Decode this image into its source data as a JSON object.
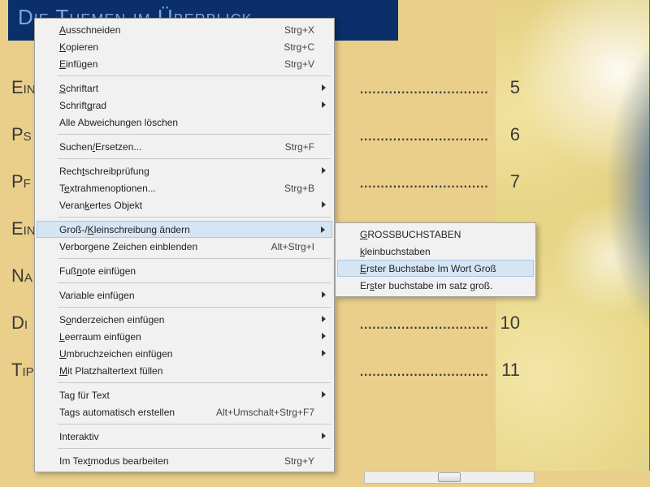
{
  "banner": {
    "title": "Die Themen im Überblick"
  },
  "toc": [
    {
      "label": "Ein",
      "num": "5",
      "dotsVisible": true
    },
    {
      "label": "Ps",
      "num": "6",
      "dotsVisible": true
    },
    {
      "label": "Pf",
      "num": "7",
      "dotsVisible": true
    },
    {
      "label": "Ein",
      "num": "",
      "dotsVisible": false
    },
    {
      "label": "Na",
      "num": "",
      "dotsVisible": false
    },
    {
      "label": "Di",
      "num": "10",
      "dotsVisible": true
    },
    {
      "label": "Tip",
      "num": "11",
      "dotsVisible": true
    }
  ],
  "dots": ".......................................",
  "menu": {
    "main": [
      {
        "type": "item",
        "label": "Ausschneiden",
        "u": 0,
        "shortcut": "Strg+X"
      },
      {
        "type": "item",
        "label": "Kopieren",
        "u": 0,
        "shortcut": "Strg+C"
      },
      {
        "type": "item",
        "label": "Einfügen",
        "u": 0,
        "shortcut": "Strg+V"
      },
      {
        "type": "sep"
      },
      {
        "type": "item",
        "label": "Schriftart",
        "u": 0,
        "submenu": true
      },
      {
        "type": "item",
        "label": "Schriftgrad",
        "u": 7,
        "submenu": true
      },
      {
        "type": "item",
        "label": "Alle Abweichungen löschen"
      },
      {
        "type": "sep"
      },
      {
        "type": "item",
        "label": "Suchen/Ersetzen...",
        "u": 6,
        "shortcut": "Strg+F"
      },
      {
        "type": "sep"
      },
      {
        "type": "item",
        "label": "Rechtschreibprüfung",
        "u": 4,
        "submenu": true
      },
      {
        "type": "item",
        "label": "Textrahmenoptionen...",
        "u": 1,
        "shortcut": "Strg+B"
      },
      {
        "type": "item",
        "label": "Verankertes Objekt",
        "u": 5,
        "submenu": true
      },
      {
        "type": "sep"
      },
      {
        "type": "item",
        "label": "Groß-/Kleinschreibung ändern",
        "u": 6,
        "submenu": true,
        "hover": true
      },
      {
        "type": "item",
        "label": "Verborgene Zeichen einblenden",
        "shortcut": "Alt+Strg+I"
      },
      {
        "type": "sep"
      },
      {
        "type": "item",
        "label": "Fußnote einfügen",
        "u": 3
      },
      {
        "type": "sep"
      },
      {
        "type": "item",
        "label": "Variable einfügen",
        "submenu": true
      },
      {
        "type": "sep"
      },
      {
        "type": "item",
        "label": "Sonderzeichen einfügen",
        "u": 1,
        "submenu": true
      },
      {
        "type": "item",
        "label": "Leerraum einfügen",
        "u": 0,
        "submenu": true
      },
      {
        "type": "item",
        "label": "Umbruchzeichen einfügen",
        "u": 0,
        "submenu": true
      },
      {
        "type": "item",
        "label": "Mit Platzhaltertext füllen",
        "u": 0
      },
      {
        "type": "sep"
      },
      {
        "type": "item",
        "label": "Tag für Text",
        "submenu": true
      },
      {
        "type": "item",
        "label": "Tags automatisch erstellen",
        "shortcut": "Alt+Umschalt+Strg+F7"
      },
      {
        "type": "sep"
      },
      {
        "type": "item",
        "label": "Interaktiv",
        "submenu": true
      },
      {
        "type": "sep"
      },
      {
        "type": "item",
        "label": "Im Textmodus bearbeiten",
        "u": 6,
        "shortcut": "Strg+Y"
      }
    ],
    "sub": [
      {
        "type": "item",
        "label": "GROSSBUCHSTABEN",
        "u": 0
      },
      {
        "type": "item",
        "label": "kleinbuchstaben",
        "u": 0
      },
      {
        "type": "item",
        "label": "Erster Buchstabe Im Wort Groß",
        "u": 0,
        "hover": true
      },
      {
        "type": "item",
        "label": "Erster buchstabe im satz groß.",
        "u": 2
      }
    ]
  }
}
